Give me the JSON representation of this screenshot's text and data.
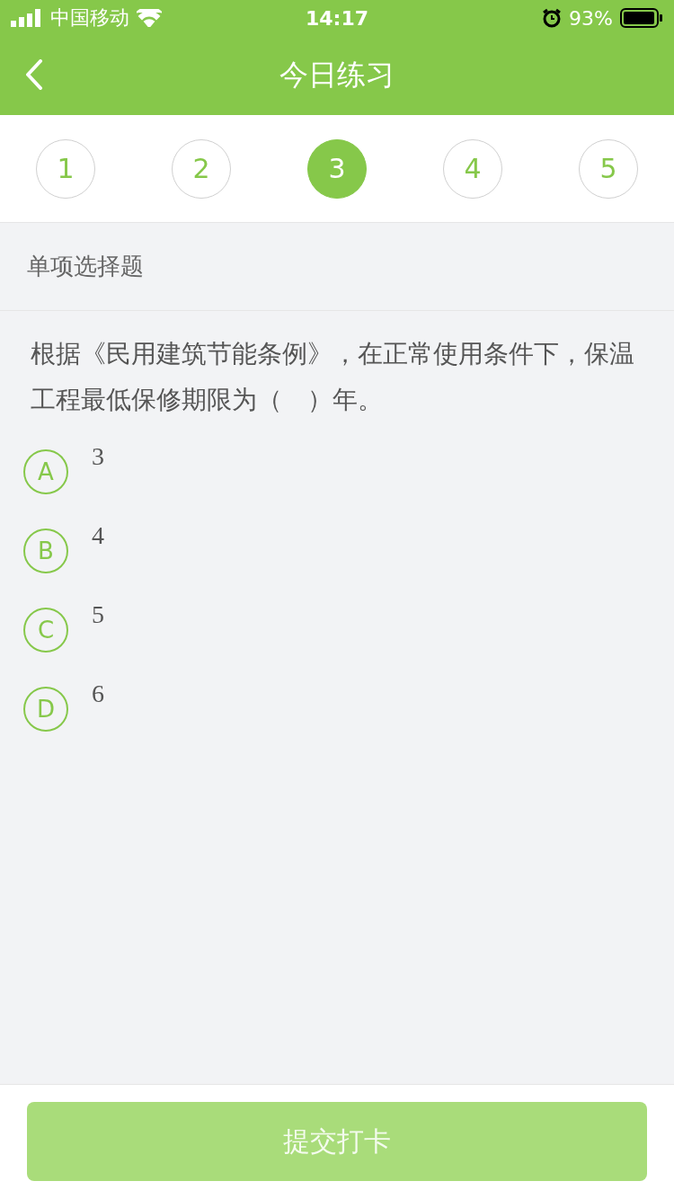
{
  "status_bar": {
    "carrier": "中国移动",
    "time": "14:17",
    "battery": "93%"
  },
  "nav": {
    "title": "今日练习"
  },
  "steps": [
    {
      "label": "1",
      "selected": false
    },
    {
      "label": "2",
      "selected": false
    },
    {
      "label": "3",
      "selected": true
    },
    {
      "label": "4",
      "selected": false
    },
    {
      "label": "5",
      "selected": false
    }
  ],
  "question_type": "单项选择题",
  "question": "根据《民用建筑节能条例》，在正常使用条件下，保温工程最低保修期限为（　）年。",
  "options": [
    {
      "letter": "A",
      "text": "3",
      "selected": false
    },
    {
      "letter": "B",
      "text": "4",
      "selected": false
    },
    {
      "letter": "C",
      "text": "5",
      "selected": false
    },
    {
      "letter": "D",
      "text": "6",
      "selected": false
    }
  ],
  "submit": {
    "label": "提交打卡",
    "disabled": true
  }
}
